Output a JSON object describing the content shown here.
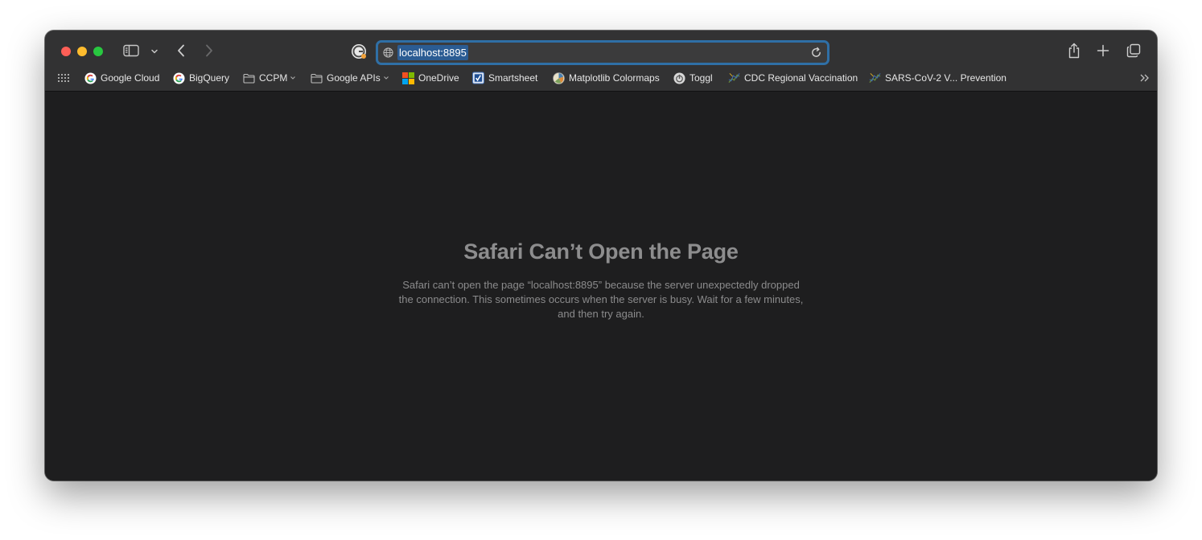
{
  "browser": {
    "name": "Safari",
    "traffic_lights": {
      "close": "#fe5f57",
      "minimize": "#febc2e",
      "zoom": "#28c840"
    },
    "toolbar": {
      "sidebar_icon": "sidebar-icon",
      "back_icon": "chevron-left-icon",
      "forward_icon": "chevron-right-icon",
      "share_icon": "share-icon",
      "new_tab_icon": "plus-icon",
      "tabs_overview_icon": "tabs-overview-icon"
    },
    "address_bar": {
      "url": "localhost:8895",
      "accent": "#2f6fa6",
      "selection": "#2b5c93"
    }
  },
  "bookmarks": [
    {
      "label": "Google Cloud",
      "icon": "google-icon"
    },
    {
      "label": "BigQuery",
      "icon": "google-icon"
    },
    {
      "label": "CCPM",
      "icon": "folder-icon",
      "dropdown": true
    },
    {
      "label": "Google APIs",
      "icon": "folder-icon",
      "dropdown": true
    },
    {
      "label": "OneDrive",
      "icon": "microsoft-icon"
    },
    {
      "label": "Smartsheet",
      "icon": "smartsheet-icon"
    },
    {
      "label": "Matplotlib Colormaps",
      "icon": "matplotlib-icon"
    },
    {
      "label": "Toggl",
      "icon": "toggl-icon"
    },
    {
      "label": "CDC Regional Vaccination",
      "icon": "cdc-icon"
    },
    {
      "label": "SARS-CoV-2 V... Prevention",
      "icon": "cdc-icon"
    }
  ],
  "error_page": {
    "title": "Safari Can’t Open the Page",
    "message_line1": "Safari can’t open the page “localhost:8895” because the server unexpectedly dropped",
    "message_line2": "the connection. This sometimes occurs when the server is busy. Wait for a few minutes,",
    "message_line3": "and then try again."
  }
}
